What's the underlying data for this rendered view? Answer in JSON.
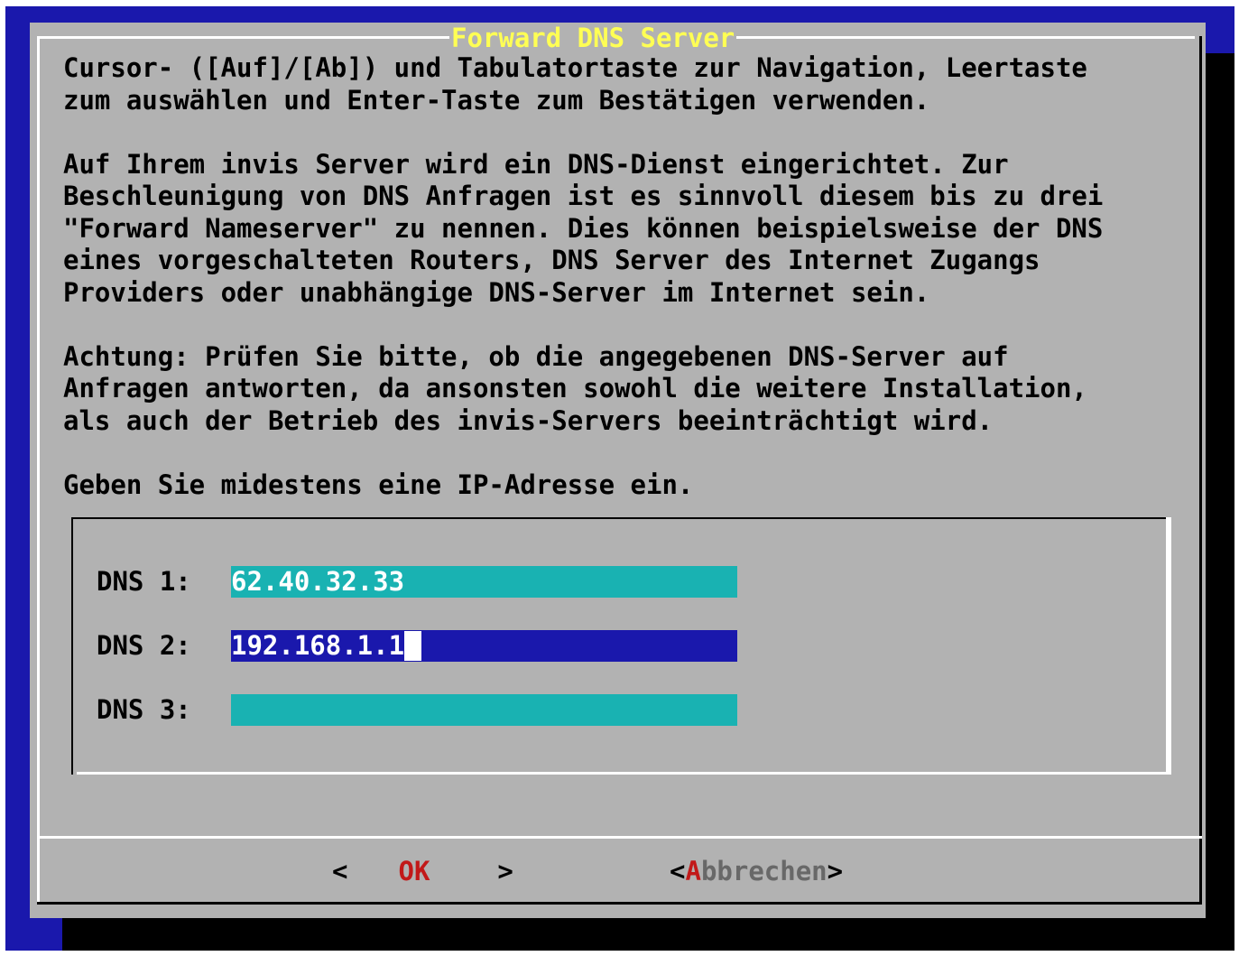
{
  "dialog": {
    "title": "Forward DNS Server",
    "help_text": "Cursor- ([Auf]/[Ab]) und Tabulatortaste zur Navigation, Leertaste\nzum auswählen und Enter-Taste zum Bestätigen verwenden.\n\nAuf Ihrem invis Server wird ein DNS-Dienst eingerichtet. Zur\nBeschleunigung von DNS Anfragen ist es sinnvoll diesem bis zu drei\n\"Forward Nameserver\" zu nennen. Dies können beispielsweise der DNS\neines vorgeschalteten Routers, DNS Server des Internet Zugangs\nProviders oder unabhängige DNS-Server im Internet sein.\n\nAchtung: Prüfen Sie bitte, ob die angegebenen DNS-Server auf\nAnfragen antworten, da ansonsten sowohl die weitere Installation,\nals auch der Betrieb des invis-Servers beeinträchtigt wird.\n\nGeben Sie midestens eine IP-Adresse ein."
  },
  "form": {
    "fields": [
      {
        "label": "DNS 1:",
        "value": "62.40.32.33"
      },
      {
        "label": "DNS 2:",
        "value": "192.168.1.1"
      },
      {
        "label": "DNS 3:",
        "value": ""
      }
    ]
  },
  "buttons": {
    "ok": {
      "left": "<",
      "hot": "O",
      "rest": "K",
      "right": ">"
    },
    "cancel": {
      "left": "<",
      "hot": "A",
      "rest": "bbrechen",
      "right": ">"
    }
  },
  "colors": {
    "screen_bg": "#1a18ac",
    "dialog_bg": "#b2b2b2",
    "title": "#ffff54",
    "field_bg": "#19b2b2",
    "field_active_bg": "#1a18ac",
    "hotkey": "#c21919"
  }
}
